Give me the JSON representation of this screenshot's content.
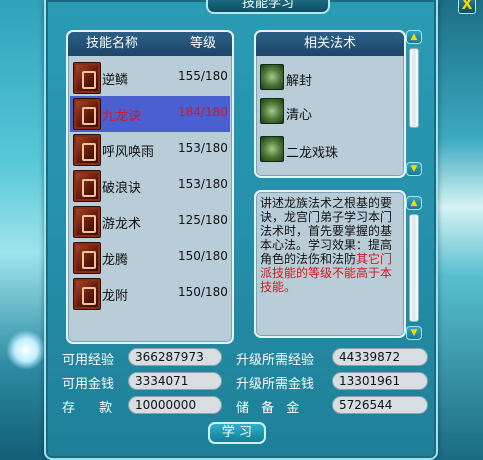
{
  "window": {
    "title": "技能学习",
    "close_label": "X"
  },
  "skill_list": {
    "header_name": "技能名称",
    "header_level": "等级",
    "skills": [
      {
        "name": "逆鳞",
        "level": "155/180",
        "selected": false
      },
      {
        "name": "九龙诀",
        "level": "184/180",
        "selected": true
      },
      {
        "name": "呼风唤雨",
        "level": "153/180",
        "selected": false
      },
      {
        "name": "破浪诀",
        "level": "153/180",
        "selected": false
      },
      {
        "name": "游龙术",
        "level": "125/180",
        "selected": false
      },
      {
        "name": "龙腾",
        "level": "150/180",
        "selected": false
      },
      {
        "name": "龙附",
        "level": "150/180",
        "selected": false
      }
    ]
  },
  "related_spells": {
    "header": "相关法术",
    "spells": [
      "解封",
      "清心",
      "二龙戏珠"
    ]
  },
  "description": {
    "text": "讲述龙族法术之根基的要诀，龙宫门弟子学习本门法术时，首先要掌握的基本心法。学习效果：提高角色的法伤和法防",
    "warning": "其它门派技能的等级不能高于本技能。"
  },
  "info": {
    "available_exp_label": "可用经验",
    "available_exp": "366287973",
    "required_exp_label": "升级所需经验",
    "required_exp": "44339872",
    "available_money_label": "可用金钱",
    "available_money": "3334071",
    "required_money_label": "升级所需金钱",
    "required_money": "13301961",
    "deposit_label": "存 款",
    "deposit": "10000000",
    "reserve_label": "储 备 金",
    "reserve": "5726544"
  },
  "learn_button": "学 习",
  "icons": {
    "scroll_up": "triangle-up-icon",
    "scroll_down": "triangle-down-icon"
  },
  "colors": {
    "selected_row": "#4a5fd0",
    "highlight_text": "#d8161b",
    "window_bg": "#2590aa"
  }
}
